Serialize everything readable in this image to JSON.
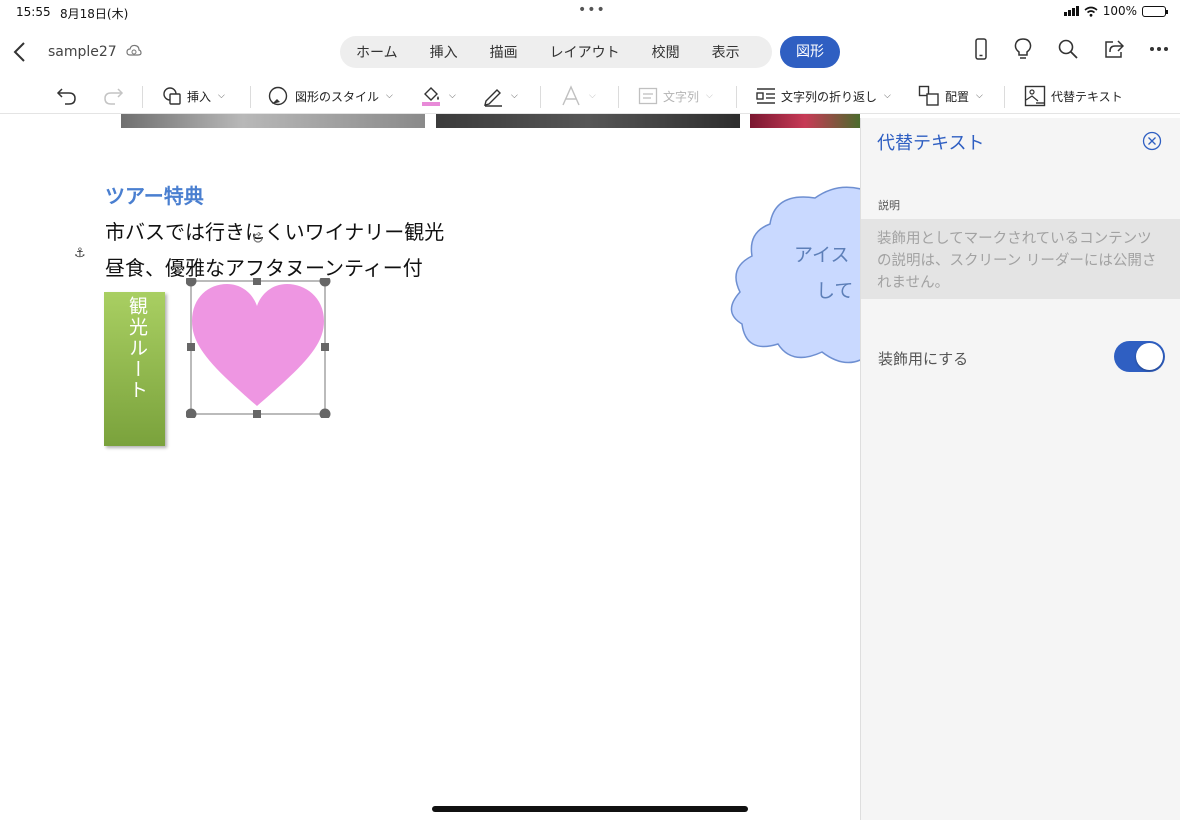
{
  "status": {
    "time": "15:55",
    "date": "8月18日(木)",
    "battery": "100%"
  },
  "header": {
    "doc_name": "sample27",
    "tabs": [
      {
        "label": "ホーム"
      },
      {
        "label": "挿入"
      },
      {
        "label": "描画"
      },
      {
        "label": "レイアウト"
      },
      {
        "label": "校閲"
      },
      {
        "label": "表示"
      }
    ],
    "active_tab": "図形"
  },
  "ribbon": {
    "insert": "挿入",
    "shape_style": "図形のスタイル",
    "text_direction": "文字列",
    "wrap_text": "文字列の折り返し",
    "arrange": "配置",
    "alt_text": "代替テキスト"
  },
  "document": {
    "heading": "ツアー特典",
    "line1": "市バスでは行きにくいワイナリー観光",
    "line2": "昼食、優雅なアフタヌーンティー付",
    "vertical_text": "観光ルート",
    "cloud_line1": "アイス",
    "cloud_line2": "して",
    "heart_color": "#ee96e2",
    "accent_color": "#4a7fd0"
  },
  "panel": {
    "title": "代替テキスト",
    "desc_label": "説明",
    "desc_text": "装飾用としてマークされているコンテンツの説明は、スクリーン リーダーには公開されません。",
    "decorative_label": "装飾用にする",
    "decorative_on": true,
    "brand_color": "#2f5fc2"
  }
}
